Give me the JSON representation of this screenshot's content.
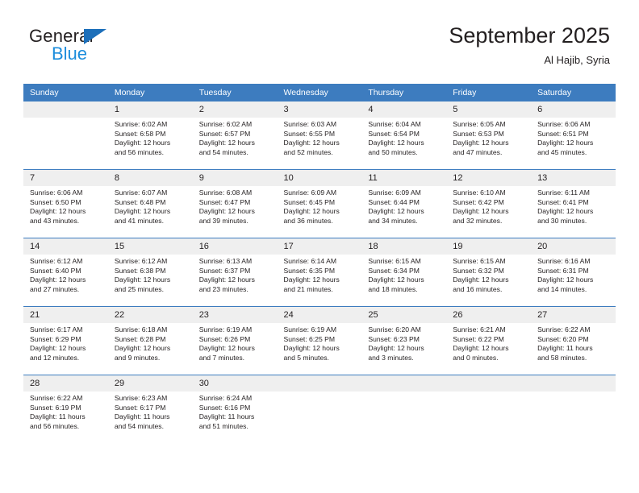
{
  "brand": {
    "name_part1": "General",
    "name_part2": "Blue",
    "triangle_color": "#1c6fba",
    "blue_text_color": "#1c8ddc"
  },
  "header": {
    "title": "September 2025",
    "subtitle": "Al Hajib, Syria"
  },
  "theme": {
    "header_row_bg": "#3d7cbf",
    "daynum_bg": "#efefef",
    "grid_line": "#3d7cbf",
    "text": "#231f20"
  },
  "weekday_headers": [
    "Sunday",
    "Monday",
    "Tuesday",
    "Wednesday",
    "Thursday",
    "Friday",
    "Saturday"
  ],
  "weeks": [
    [
      {
        "day": "",
        "sunrise": "",
        "sunset": "",
        "daylight_line1": "",
        "daylight_line2": ""
      },
      {
        "day": "1",
        "sunrise": "Sunrise: 6:02 AM",
        "sunset": "Sunset: 6:58 PM",
        "daylight_line1": "Daylight: 12 hours",
        "daylight_line2": "and 56 minutes."
      },
      {
        "day": "2",
        "sunrise": "Sunrise: 6:02 AM",
        "sunset": "Sunset: 6:57 PM",
        "daylight_line1": "Daylight: 12 hours",
        "daylight_line2": "and 54 minutes."
      },
      {
        "day": "3",
        "sunrise": "Sunrise: 6:03 AM",
        "sunset": "Sunset: 6:55 PM",
        "daylight_line1": "Daylight: 12 hours",
        "daylight_line2": "and 52 minutes."
      },
      {
        "day": "4",
        "sunrise": "Sunrise: 6:04 AM",
        "sunset": "Sunset: 6:54 PM",
        "daylight_line1": "Daylight: 12 hours",
        "daylight_line2": "and 50 minutes."
      },
      {
        "day": "5",
        "sunrise": "Sunrise: 6:05 AM",
        "sunset": "Sunset: 6:53 PM",
        "daylight_line1": "Daylight: 12 hours",
        "daylight_line2": "and 47 minutes."
      },
      {
        "day": "6",
        "sunrise": "Sunrise: 6:06 AM",
        "sunset": "Sunset: 6:51 PM",
        "daylight_line1": "Daylight: 12 hours",
        "daylight_line2": "and 45 minutes."
      }
    ],
    [
      {
        "day": "7",
        "sunrise": "Sunrise: 6:06 AM",
        "sunset": "Sunset: 6:50 PM",
        "daylight_line1": "Daylight: 12 hours",
        "daylight_line2": "and 43 minutes."
      },
      {
        "day": "8",
        "sunrise": "Sunrise: 6:07 AM",
        "sunset": "Sunset: 6:48 PM",
        "daylight_line1": "Daylight: 12 hours",
        "daylight_line2": "and 41 minutes."
      },
      {
        "day": "9",
        "sunrise": "Sunrise: 6:08 AM",
        "sunset": "Sunset: 6:47 PM",
        "daylight_line1": "Daylight: 12 hours",
        "daylight_line2": "and 39 minutes."
      },
      {
        "day": "10",
        "sunrise": "Sunrise: 6:09 AM",
        "sunset": "Sunset: 6:45 PM",
        "daylight_line1": "Daylight: 12 hours",
        "daylight_line2": "and 36 minutes."
      },
      {
        "day": "11",
        "sunrise": "Sunrise: 6:09 AM",
        "sunset": "Sunset: 6:44 PM",
        "daylight_line1": "Daylight: 12 hours",
        "daylight_line2": "and 34 minutes."
      },
      {
        "day": "12",
        "sunrise": "Sunrise: 6:10 AM",
        "sunset": "Sunset: 6:42 PM",
        "daylight_line1": "Daylight: 12 hours",
        "daylight_line2": "and 32 minutes."
      },
      {
        "day": "13",
        "sunrise": "Sunrise: 6:11 AM",
        "sunset": "Sunset: 6:41 PM",
        "daylight_line1": "Daylight: 12 hours",
        "daylight_line2": "and 30 minutes."
      }
    ],
    [
      {
        "day": "14",
        "sunrise": "Sunrise: 6:12 AM",
        "sunset": "Sunset: 6:40 PM",
        "daylight_line1": "Daylight: 12 hours",
        "daylight_line2": "and 27 minutes."
      },
      {
        "day": "15",
        "sunrise": "Sunrise: 6:12 AM",
        "sunset": "Sunset: 6:38 PM",
        "daylight_line1": "Daylight: 12 hours",
        "daylight_line2": "and 25 minutes."
      },
      {
        "day": "16",
        "sunrise": "Sunrise: 6:13 AM",
        "sunset": "Sunset: 6:37 PM",
        "daylight_line1": "Daylight: 12 hours",
        "daylight_line2": "and 23 minutes."
      },
      {
        "day": "17",
        "sunrise": "Sunrise: 6:14 AM",
        "sunset": "Sunset: 6:35 PM",
        "daylight_line1": "Daylight: 12 hours",
        "daylight_line2": "and 21 minutes."
      },
      {
        "day": "18",
        "sunrise": "Sunrise: 6:15 AM",
        "sunset": "Sunset: 6:34 PM",
        "daylight_line1": "Daylight: 12 hours",
        "daylight_line2": "and 18 minutes."
      },
      {
        "day": "19",
        "sunrise": "Sunrise: 6:15 AM",
        "sunset": "Sunset: 6:32 PM",
        "daylight_line1": "Daylight: 12 hours",
        "daylight_line2": "and 16 minutes."
      },
      {
        "day": "20",
        "sunrise": "Sunrise: 6:16 AM",
        "sunset": "Sunset: 6:31 PM",
        "daylight_line1": "Daylight: 12 hours",
        "daylight_line2": "and 14 minutes."
      }
    ],
    [
      {
        "day": "21",
        "sunrise": "Sunrise: 6:17 AM",
        "sunset": "Sunset: 6:29 PM",
        "daylight_line1": "Daylight: 12 hours",
        "daylight_line2": "and 12 minutes."
      },
      {
        "day": "22",
        "sunrise": "Sunrise: 6:18 AM",
        "sunset": "Sunset: 6:28 PM",
        "daylight_line1": "Daylight: 12 hours",
        "daylight_line2": "and 9 minutes."
      },
      {
        "day": "23",
        "sunrise": "Sunrise: 6:19 AM",
        "sunset": "Sunset: 6:26 PM",
        "daylight_line1": "Daylight: 12 hours",
        "daylight_line2": "and 7 minutes."
      },
      {
        "day": "24",
        "sunrise": "Sunrise: 6:19 AM",
        "sunset": "Sunset: 6:25 PM",
        "daylight_line1": "Daylight: 12 hours",
        "daylight_line2": "and 5 minutes."
      },
      {
        "day": "25",
        "sunrise": "Sunrise: 6:20 AM",
        "sunset": "Sunset: 6:23 PM",
        "daylight_line1": "Daylight: 12 hours",
        "daylight_line2": "and 3 minutes."
      },
      {
        "day": "26",
        "sunrise": "Sunrise: 6:21 AM",
        "sunset": "Sunset: 6:22 PM",
        "daylight_line1": "Daylight: 12 hours",
        "daylight_line2": "and 0 minutes."
      },
      {
        "day": "27",
        "sunrise": "Sunrise: 6:22 AM",
        "sunset": "Sunset: 6:20 PM",
        "daylight_line1": "Daylight: 11 hours",
        "daylight_line2": "and 58 minutes."
      }
    ],
    [
      {
        "day": "28",
        "sunrise": "Sunrise: 6:22 AM",
        "sunset": "Sunset: 6:19 PM",
        "daylight_line1": "Daylight: 11 hours",
        "daylight_line2": "and 56 minutes."
      },
      {
        "day": "29",
        "sunrise": "Sunrise: 6:23 AM",
        "sunset": "Sunset: 6:17 PM",
        "daylight_line1": "Daylight: 11 hours",
        "daylight_line2": "and 54 minutes."
      },
      {
        "day": "30",
        "sunrise": "Sunrise: 6:24 AM",
        "sunset": "Sunset: 6:16 PM",
        "daylight_line1": "Daylight: 11 hours",
        "daylight_line2": "and 51 minutes."
      },
      {
        "day": "",
        "sunrise": "",
        "sunset": "",
        "daylight_line1": "",
        "daylight_line2": ""
      },
      {
        "day": "",
        "sunrise": "",
        "sunset": "",
        "daylight_line1": "",
        "daylight_line2": ""
      },
      {
        "day": "",
        "sunrise": "",
        "sunset": "",
        "daylight_line1": "",
        "daylight_line2": ""
      },
      {
        "day": "",
        "sunrise": "",
        "sunset": "",
        "daylight_line1": "",
        "daylight_line2": ""
      }
    ]
  ]
}
